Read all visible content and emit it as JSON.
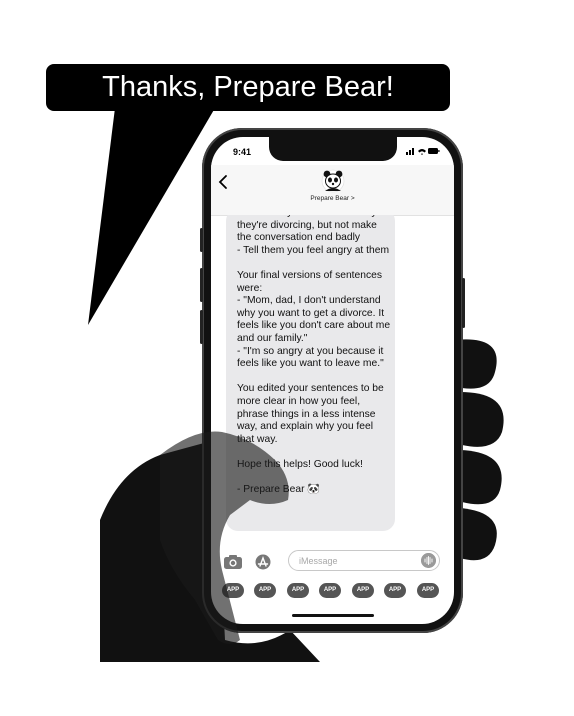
{
  "banner": {
    "text": "Thanks, Prepare Bear!"
  },
  "phone": {
    "status_time": "9:41",
    "contact_name": "Prepare Bear >",
    "message_text": "- Tell them you don't know why they're divorcing, but not make the conversation end badly\n- Tell them you feel angry at them\n\nYour final versions of sentences were:\n- \"Mom, dad, I don't understand why you want to get a divorce. It feels like you don't care about me and our family.\"\n- \"I'm so angry at you because it feels like you want to leave me.\"\n\nYou edited your sentences to be more clear in how you feel, phrase things in a less intense way, and explain why you feel that way.\n\nHope this helps! Good luck!\n\n- Prepare Bear 🐼",
    "input_placeholder": "iMessage",
    "app_labels": [
      "APP",
      "APP",
      "APP",
      "APP",
      "APP",
      "APP",
      "APP"
    ]
  },
  "icons": {
    "back": "chevron-left-icon",
    "camera": "camera-icon",
    "appstore": "app-store-icon",
    "mic": "audio-waveform-icon",
    "avatar": "panda-avatar-icon"
  },
  "colors": {
    "bubble": "#000000",
    "message_bubble": "#e9e9eb",
    "hand": "#2a2a2a"
  }
}
